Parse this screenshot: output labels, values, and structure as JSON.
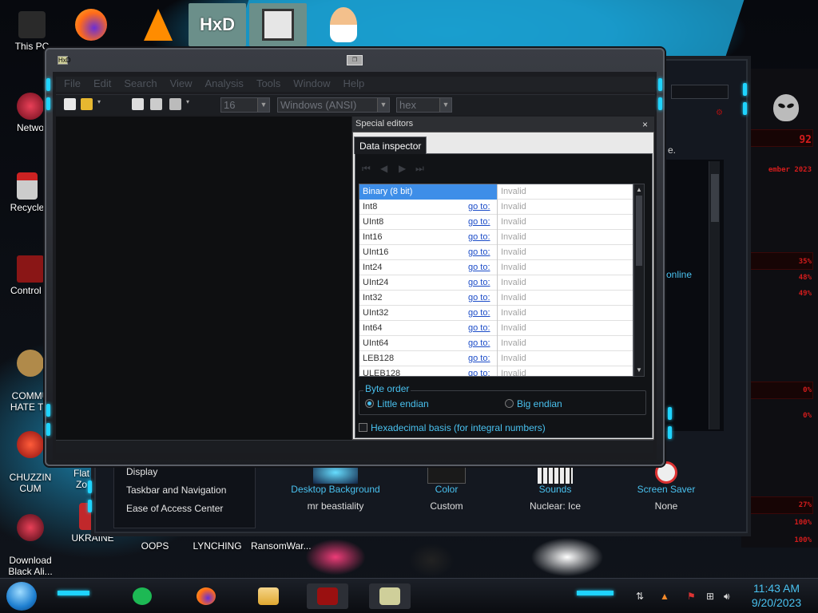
{
  "desktop": {
    "left_icons": [
      {
        "label": "This PC",
        "color": "#333333"
      },
      {
        "label": "Netwo",
        "color": "#c0243a"
      },
      {
        "label": "Recycle",
        "color": "#d8d8d8"
      },
      {
        "label": "Control P",
        "color": "#aa1d1d"
      },
      {
        "label": "COMMU\nHATE TH",
        "color": "#b08a4a"
      },
      {
        "label": "CHUZZIN\nCUM",
        "color": "#d23a2a"
      },
      {
        "label": "Download\nBlack Ali...",
        "color": "#b01c30"
      }
    ],
    "bottom_icons": [
      {
        "label": "Flat\nZo",
        "color": "#444444"
      },
      {
        "label": "UKRAINE",
        "color": "#c1282b"
      },
      {
        "label": "OOPS",
        "color": "#222222"
      },
      {
        "label": "LYNCHING",
        "color": "#222222"
      },
      {
        "label": "RansomWar...",
        "color": "#222222"
      }
    ],
    "top_icons": [
      "firefox-icon",
      "vlc-icon",
      "hxd-icon",
      "maze-app-icon",
      "doctor-icon"
    ]
  },
  "gauges": {
    "values": [
      "92",
      "ember 2023",
      "35%",
      "48%",
      "49%",
      "0%",
      "0%",
      "27%",
      "100%",
      "100%"
    ]
  },
  "back_window": {
    "sidebar_links": [
      "Display",
      "Taskbar and Navigation",
      "Ease of Access Center"
    ],
    "personalization": [
      {
        "label": "Desktop Background",
        "value": "mr beastiality"
      },
      {
        "label": "Color",
        "value": "Custom"
      },
      {
        "label": "Sounds",
        "value": "Nuclear: Ice"
      },
      {
        "label": "Screen Saver",
        "value": "None"
      }
    ],
    "online_text": "online",
    "dot_text": "e."
  },
  "hxd": {
    "title_icon": "HxD",
    "menu": [
      "File",
      "Edit",
      "Search",
      "View",
      "Analysis",
      "Tools",
      "Window",
      "Help"
    ],
    "toolbar": {
      "bytes_per_row": "16",
      "charset": "Windows (ANSI)",
      "offset_base": "hex"
    },
    "special_editors": {
      "title": "Special editors",
      "close": "×",
      "tab": "Data inspector",
      "rows": [
        {
          "name": "Binary (8 bit)",
          "goto": "",
          "value": "Invalid"
        },
        {
          "name": "Int8",
          "goto": "go to:",
          "value": "Invalid"
        },
        {
          "name": "UInt8",
          "goto": "go to:",
          "value": "Invalid"
        },
        {
          "name": "Int16",
          "goto": "go to:",
          "value": "Invalid"
        },
        {
          "name": "UInt16",
          "goto": "go to:",
          "value": "Invalid"
        },
        {
          "name": "Int24",
          "goto": "go to:",
          "value": "Invalid"
        },
        {
          "name": "UInt24",
          "goto": "go to:",
          "value": "Invalid"
        },
        {
          "name": "Int32",
          "goto": "go to:",
          "value": "Invalid"
        },
        {
          "name": "UInt32",
          "goto": "go to:",
          "value": "Invalid"
        },
        {
          "name": "Int64",
          "goto": "go to:",
          "value": "Invalid"
        },
        {
          "name": "UInt64",
          "goto": "go to:",
          "value": "Invalid"
        },
        {
          "name": "LEB128",
          "goto": "go to:",
          "value": "Invalid"
        },
        {
          "name": "ULEB128",
          "goto": "go to:",
          "value": "Invalid"
        }
      ],
      "byte_order": {
        "title": "Byte order",
        "little": "Little endian",
        "big": "Big endian",
        "selected": "little"
      },
      "hex_basis": "Hexadecimal basis (for integral numbers)"
    }
  },
  "taskbar": {
    "apps": [
      "notes-app-icon",
      "firefox-icon",
      "file-explorer-icon",
      "alienware-app-icon",
      "hxd-icon"
    ],
    "time": "11:43 AM",
    "date": "9/20/2023"
  }
}
